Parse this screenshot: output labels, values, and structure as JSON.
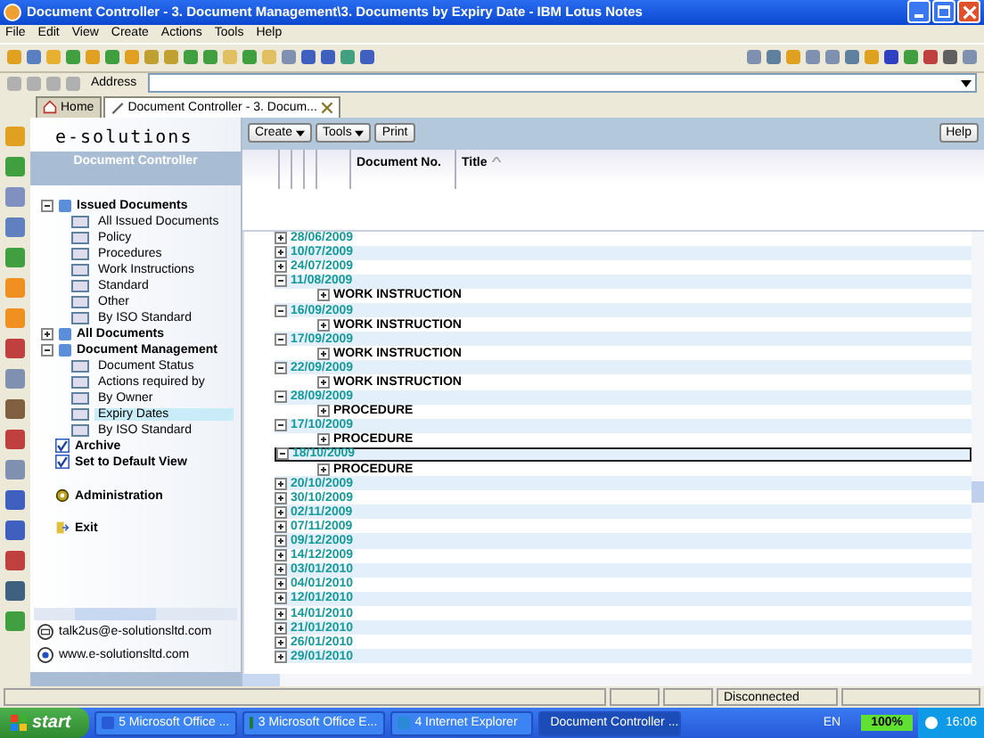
{
  "window": {
    "title": "Document Controller - 3. Document Management\\3. Documents by Expiry Date - IBM Lotus Notes"
  },
  "menu": [
    "File",
    "Edit",
    "View",
    "Create",
    "Actions",
    "Tools",
    "Help"
  ],
  "address": {
    "label": "Address"
  },
  "tabs": [
    {
      "label": "Home",
      "selected": false,
      "kind": "home"
    },
    {
      "label": "Document Controller - 3. Docum...",
      "selected": true,
      "kind": "doc"
    }
  ],
  "sidebar": {
    "logo": "e-solutions",
    "subtitle": "Document Controller",
    "tree": [
      {
        "label": "Issued Documents",
        "expanded": true,
        "children": [
          {
            "label": "All Issued Documents",
            "selected": false
          },
          {
            "label": "Policy",
            "selected": false
          },
          {
            "label": "Procedures",
            "selected": false
          },
          {
            "label": "Work Instructions",
            "selected": false
          },
          {
            "label": "Standard",
            "selected": false
          },
          {
            "label": "Other",
            "selected": false
          },
          {
            "label": "By ISO Standard",
            "selected": false
          }
        ]
      },
      {
        "label": "All Documents",
        "expanded": false
      },
      {
        "label": "Document Management",
        "expanded": true,
        "children": [
          {
            "label": "Document Status",
            "selected": false
          },
          {
            "label": "Actions required by",
            "selected": false
          },
          {
            "label": "By Owner",
            "selected": false
          },
          {
            "label": "Expiry Dates",
            "selected": true
          },
          {
            "label": "By ISO Standard",
            "selected": false
          }
        ]
      }
    ],
    "actions": [
      {
        "label": "Archive",
        "kind": "check"
      },
      {
        "label": "Set to Default View",
        "kind": "check"
      },
      {
        "label": "Administration",
        "kind": "admin"
      },
      {
        "label": "Exit",
        "kind": "exit"
      }
    ],
    "contacts": [
      {
        "label": "talk2us@e-solutionsltd.com",
        "kind": "mail"
      },
      {
        "label": "www.e-solutionsltd.com",
        "kind": "web"
      }
    ]
  },
  "view": {
    "buttons": [
      {
        "label": "Create",
        "dropdown": true
      },
      {
        "label": "Tools",
        "dropdown": true
      },
      {
        "label": "Print",
        "dropdown": false
      }
    ],
    "help": "Help",
    "columns": [
      "Document No.",
      "Title"
    ],
    "rows": [
      {
        "date": "28/06/2009",
        "expanded": false,
        "selected": false
      },
      {
        "date": "10/07/2009",
        "expanded": false,
        "selected": false
      },
      {
        "date": "24/07/2009",
        "expanded": false,
        "selected": false
      },
      {
        "date": "11/08/2009",
        "expanded": true,
        "selected": false,
        "children": [
          "WORK INSTRUCTION"
        ]
      },
      {
        "date": "16/09/2009",
        "expanded": true,
        "selected": false,
        "children": [
          "WORK INSTRUCTION"
        ]
      },
      {
        "date": "17/09/2009",
        "expanded": true,
        "selected": false,
        "children": [
          "WORK INSTRUCTION"
        ]
      },
      {
        "date": "22/09/2009",
        "expanded": true,
        "selected": false,
        "children": [
          "WORK INSTRUCTION"
        ]
      },
      {
        "date": "28/09/2009",
        "expanded": true,
        "selected": false,
        "children": [
          "PROCEDURE"
        ]
      },
      {
        "date": "17/10/2009",
        "expanded": true,
        "selected": false,
        "children": [
          "PROCEDURE"
        ]
      },
      {
        "date": "18/10/2009",
        "expanded": true,
        "selected": true,
        "children": [
          "PROCEDURE"
        ]
      },
      {
        "date": "20/10/2009",
        "expanded": false,
        "selected": false
      },
      {
        "date": "30/10/2009",
        "expanded": false,
        "selected": false
      },
      {
        "date": "02/11/2009",
        "expanded": false,
        "selected": false
      },
      {
        "date": "07/11/2009",
        "expanded": false,
        "selected": false
      },
      {
        "date": "09/12/2009",
        "expanded": false,
        "selected": false
      },
      {
        "date": "14/12/2009",
        "expanded": false,
        "selected": false
      },
      {
        "date": "03/01/2010",
        "expanded": false,
        "selected": false
      },
      {
        "date": "04/01/2010",
        "expanded": false,
        "selected": false
      },
      {
        "date": "12/01/2010",
        "expanded": false,
        "selected": false
      },
      {
        "date": "14/01/2010",
        "expanded": false,
        "selected": false
      },
      {
        "date": "21/01/2010",
        "expanded": false,
        "selected": false
      },
      {
        "date": "26/01/2010",
        "expanded": false,
        "selected": false
      },
      {
        "date": "29/01/2010",
        "expanded": false,
        "selected": false
      }
    ]
  },
  "status_bar": {
    "connection": "Disconnected"
  },
  "taskbar": {
    "start": "start",
    "items": [
      {
        "label": "5 Microsoft Office ...",
        "kind": "word",
        "selected": false
      },
      {
        "label": "3 Microsoft Office E...",
        "kind": "excel",
        "selected": false
      },
      {
        "label": "4 Internet Explorer",
        "kind": "ie",
        "selected": false
      },
      {
        "label": "Document Controller ...",
        "kind": "notes",
        "selected": true
      }
    ],
    "language": "EN",
    "battery": "100%",
    "clock": "16:06"
  }
}
